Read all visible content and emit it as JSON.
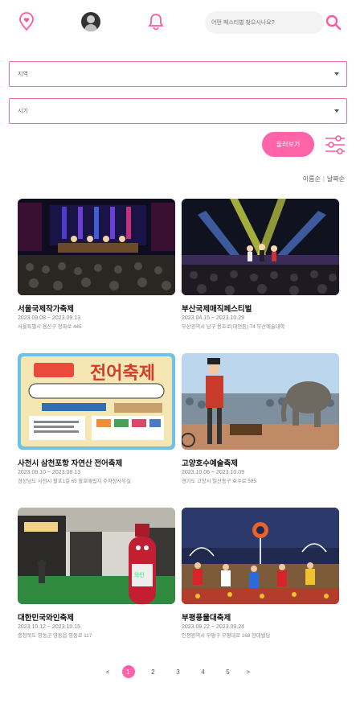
{
  "header": {
    "search_placeholder": "어떤 페스티벌 찾으시나요?"
  },
  "filters": {
    "region_label": "지역",
    "period_label": "시기",
    "filter_button": "둘러보기"
  },
  "sort": {
    "option1": "이름순",
    "option2": "날짜순"
  },
  "festivals": [
    {
      "title": "서울국제작가축제",
      "date": "2023.09.08 ~ 2023.09.13",
      "address": "서울특별시 용산구 청파로 445"
    },
    {
      "title": "부산국제매직페스티벌",
      "date": "2023.04.15 ~ 2023.10.29",
      "address": "부산광역시 남구 용호로(대연동) 74 부산예술대학"
    },
    {
      "title": "사천시 삼천포항 자연산 전어축제",
      "date": "2023.08.10 ~ 2023.08.13",
      "address": "경상남도 사천시 팔포1길 65 팔포매립지 주차장사무실"
    },
    {
      "title": "고양호수예술축제",
      "date": "2023.10.06 ~ 2023.10.09",
      "address": "경기도 고양시 일산동구 호수로 595"
    },
    {
      "title": "대한민국와인축제",
      "date": "2023.10.12 ~ 2023.10.15",
      "address": "충청북도 영동군 영동읍 영동로 117"
    },
    {
      "title": "부평풍물대축제",
      "date": "2023.09.22 ~ 2023.09.24",
      "address": "인천광역시 부평구 부평대로 168 현대빌딩"
    }
  ],
  "pagination": {
    "prev": "<",
    "pages": [
      "1",
      "2",
      "3",
      "4",
      "5"
    ],
    "next": ">",
    "current": "1"
  },
  "colors": {
    "accent": "#ff63a8",
    "border": "#f06aa5"
  },
  "icons": [
    "location-heart-icon",
    "bell-icon",
    "search-icon",
    "sliders-icon",
    "avatar"
  ]
}
